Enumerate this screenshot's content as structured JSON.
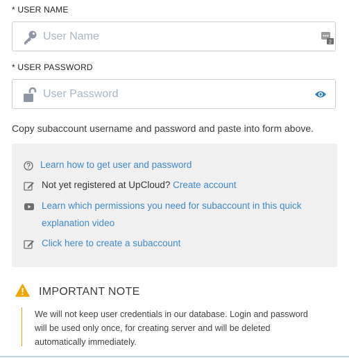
{
  "username": {
    "label": "* USER NAME",
    "placeholder": "User Name",
    "value": ""
  },
  "password": {
    "label": "* USER PASSWORD",
    "placeholder": "User Password",
    "value": ""
  },
  "password_manager_badge": "2",
  "copy_instruction": "Copy subaccount username and password and paste into form above.",
  "info_box": {
    "items": [
      {
        "icon": "help-circle-icon",
        "link": "Learn how to get user and password"
      },
      {
        "icon": "edit-icon",
        "text": "Not yet registered at UpCloud?",
        "link": "Create account"
      },
      {
        "icon": "video-icon",
        "link_line1": "Learn which permissions you need for subaccount in this quick",
        "link_line2": "explanation video"
      },
      {
        "icon": "edit-icon",
        "link": "Click here to create a subaccount"
      }
    ]
  },
  "important_note": {
    "title": "IMPORTANT NOTE",
    "line1": "We will not keep user credentials in our database. Login and password",
    "line2": "will be used only once, for creating server and will be deleted",
    "line3": "automatically immediately."
  },
  "colors": {
    "link": "#3f89c9",
    "warning": "#f0a500",
    "box_bg": "#f0f0f0"
  }
}
